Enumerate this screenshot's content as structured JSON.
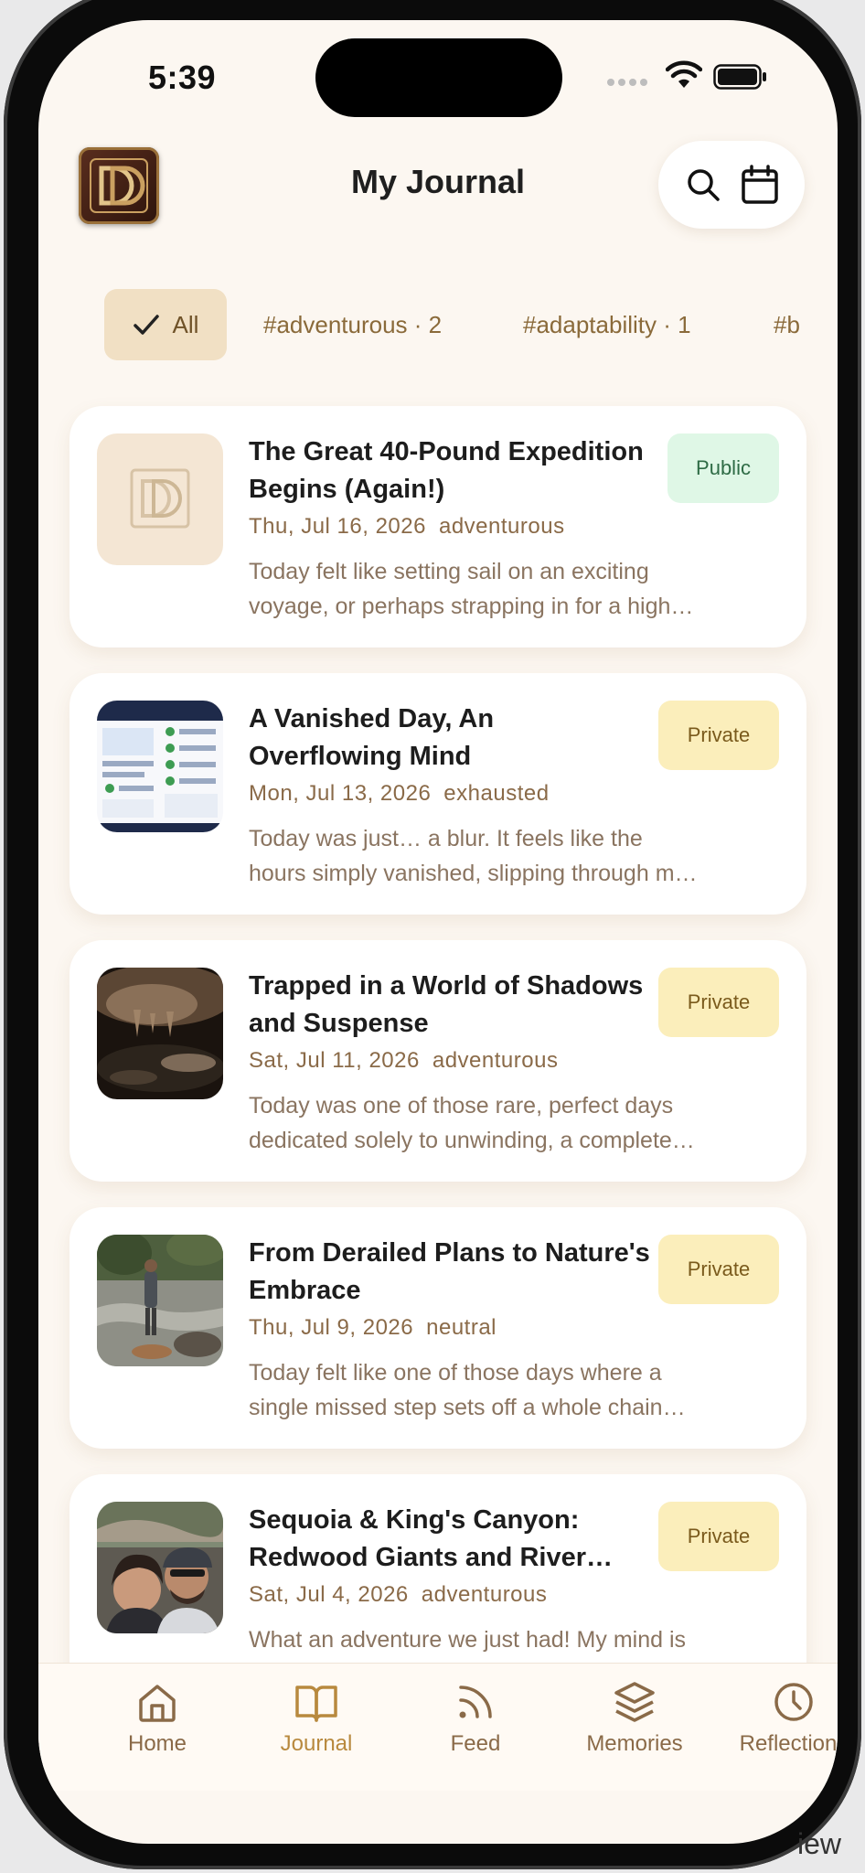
{
  "status_bar": {
    "time": "5:39"
  },
  "header": {
    "title": "My Journal",
    "logo_icon": "dd-monogram-logo",
    "search_icon": "search-icon",
    "calendar_icon": "calendar-icon"
  },
  "filters": [
    {
      "label": "All",
      "active": true
    },
    {
      "label": "#adventurous · 2"
    },
    {
      "label": "#adaptability · 1"
    },
    {
      "label": "#b"
    }
  ],
  "entries": [
    {
      "title": "The Great 40-Pound Expedition Begins (Again!)",
      "date": "Thu, Jul 16, 2026",
      "mood": "adventurous",
      "excerpt_line1": "Today felt like setting sail on an exciting",
      "excerpt_line2": "voyage, or perhaps strapping in for a high…",
      "visibility": "Public"
    },
    {
      "title": "A Vanished Day, An Overflowing Mind",
      "date": "Mon, Jul 13, 2026",
      "mood": "exhausted",
      "excerpt_line1": "Today was just… a blur. It feels like the",
      "excerpt_line2": "hours simply vanished, slipping through m…",
      "visibility": "Private"
    },
    {
      "title": "Trapped in a World of Shadows and Suspense",
      "date": "Sat, Jul 11, 2026",
      "mood": "adventurous",
      "excerpt_line1": "Today was one of those rare, perfect days",
      "excerpt_line2": "dedicated solely to unwinding, a complete…",
      "visibility": "Private"
    },
    {
      "title": "From Derailed Plans to Nature's Embrace",
      "date": "Thu, Jul 9, 2026",
      "mood": "neutral",
      "excerpt_line1": "Today felt like one of those days where a",
      "excerpt_line2": "single missed step sets off a whole chain…",
      "visibility": "Private"
    },
    {
      "title": "Sequoia & King's Canyon: Redwood Giants and River…",
      "date": "Sat, Jul 4, 2026",
      "mood": "adventurous",
      "excerpt_line1": "What an adventure we just had! My mind is",
      "excerpt_line2": "",
      "visibility": "Private"
    }
  ],
  "tabbar": [
    {
      "label": "Home",
      "icon": "home-icon"
    },
    {
      "label": "Journal",
      "icon": "book-icon",
      "active": true
    },
    {
      "label": "Feed",
      "icon": "rss-icon"
    },
    {
      "label": "Memories",
      "icon": "layers-icon"
    },
    {
      "label": "Reflections",
      "icon": "clock-icon"
    }
  ],
  "corner_text": "iew",
  "colors": {
    "background": "#fcf7f1",
    "accent": "#b8893e",
    "public_badge": "#dff7e6",
    "private_badge": "#fbeebb"
  }
}
